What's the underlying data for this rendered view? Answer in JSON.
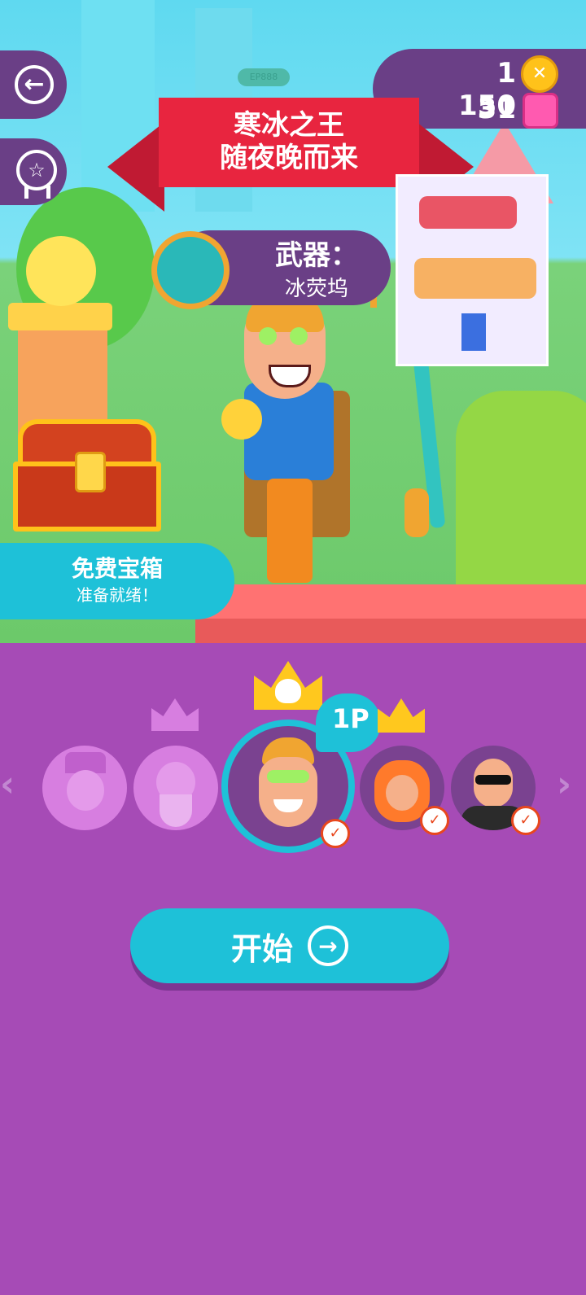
{
  "header": {
    "coins": "1 150",
    "gems": "31",
    "tag": "EP888"
  },
  "banner": {
    "line1": "寒冰之王",
    "line2": "随夜晚而来"
  },
  "weapon": {
    "label": "武器：",
    "name": "冰荧坞"
  },
  "free_chest": {
    "title": "免费宝箱",
    "subtitle": "准备就绪！"
  },
  "selector": {
    "player_badge": "1P",
    "left_arrow": "‹",
    "right_arrow": "›",
    "characters": [
      {
        "name": "witch",
        "unlocked": false
      },
      {
        "name": "viking",
        "unlocked": false
      },
      {
        "name": "ice-king",
        "unlocked": true,
        "selected": true
      },
      {
        "name": "fox-girl",
        "unlocked": true
      },
      {
        "name": "sunglasses-man",
        "unlocked": true
      }
    ]
  },
  "start": {
    "label": "开始"
  },
  "colors": {
    "ribbon": "#e8253f",
    "panel": "#6a3f86",
    "accent": "#1ec1d8",
    "background": "#a64bb6",
    "check": "#e8471d"
  },
  "icons": [
    "back-arrow-icon",
    "achievement-ribbon-icon",
    "coin-icon",
    "gem-icon",
    "arrow-right-circle-icon",
    "skull-crown-icon",
    "lock-icon"
  ]
}
